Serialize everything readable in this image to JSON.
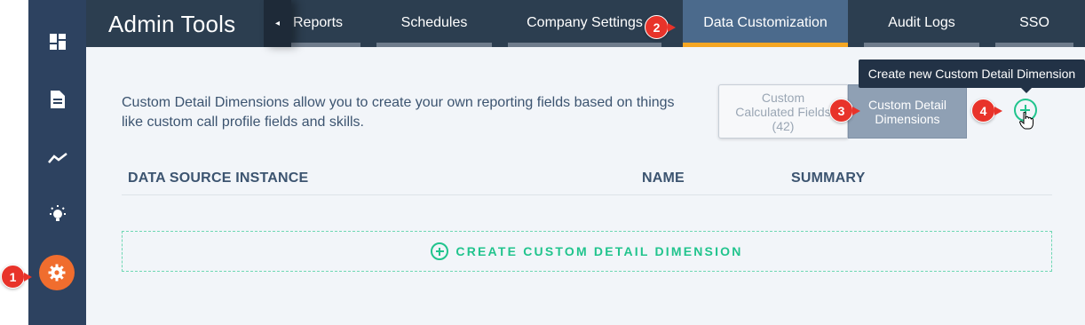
{
  "app": {
    "title": "Admin Tools"
  },
  "tabs": [
    {
      "label": "Reports",
      "active": false
    },
    {
      "label": "Schedules",
      "active": false
    },
    {
      "label": "Company Settings",
      "active": false
    },
    {
      "label": "Data Customization",
      "active": true
    },
    {
      "label": "Audit Logs",
      "active": false
    },
    {
      "label": "SSO",
      "active": false
    }
  ],
  "sidebar": {
    "items": [
      {
        "icon": "dashboard-icon"
      },
      {
        "icon": "document-icon"
      },
      {
        "icon": "trend-icon"
      },
      {
        "icon": "lightbulb-icon"
      },
      {
        "icon": "gear-icon",
        "active": true
      }
    ]
  },
  "main": {
    "description": "Custom Detail Dimensions allow you to create your own reporting fields based on things like custom call profile fields and skills.",
    "toggle": {
      "calculated_line1": "Custom",
      "calculated_line2": "Calculated Fields",
      "calculated_count": "(42)",
      "dimensions_line1": "Custom Detail",
      "dimensions_line2": "Dimensions"
    },
    "tooltip": "Create new Custom Detail Dimension",
    "table": {
      "columns": [
        "DATA SOURCE INSTANCE",
        "NAME",
        "SUMMARY"
      ]
    },
    "create_label": "CREATE CUSTOM DETAIL DIMENSION"
  },
  "callouts": [
    "1",
    "2",
    "3",
    "4"
  ],
  "colors": {
    "accent_green": "#21c48d",
    "active_tab_underline": "#f5a623",
    "callout_red": "#e8332a",
    "active_nav_orange": "#f06d2e"
  }
}
